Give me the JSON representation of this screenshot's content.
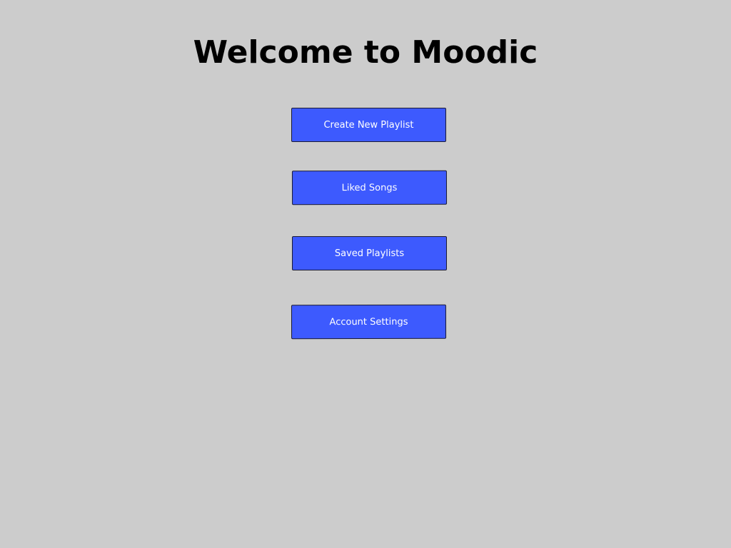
{
  "title": "Welcome to Moodic",
  "colors": {
    "background": "#cccccc",
    "button": "#3d5afe",
    "button_text": "#ffffff",
    "title_text": "#000000"
  },
  "menu": {
    "create_playlist": "Create New Playlist",
    "liked_songs": "Liked Songs",
    "saved_playlists": "Saved Playlists",
    "account_settings": "Account Settings"
  }
}
